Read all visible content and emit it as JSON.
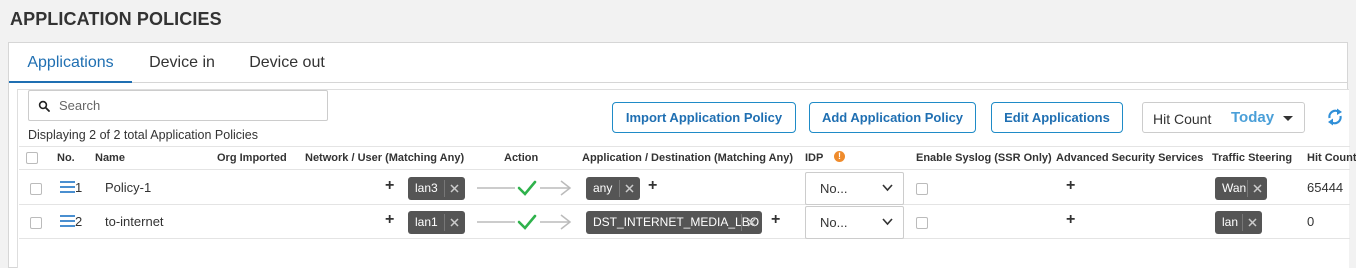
{
  "page": {
    "title": "APPLICATION POLICIES"
  },
  "tabs": [
    {
      "label": "Applications",
      "active": true
    },
    {
      "label": "Device in",
      "active": false
    },
    {
      "label": "Device out",
      "active": false
    }
  ],
  "search": {
    "placeholder": "Search",
    "value": ""
  },
  "summary": "Displaying 2 of 2 total Application Policies",
  "toolbar": {
    "import_label": "Import Application Policy",
    "add_label": "Add Application Policy",
    "edit_label": "Edit Applications",
    "hit_count_label": "Hit Count",
    "hit_count_value": "Today"
  },
  "table": {
    "columns": {
      "no": "No.",
      "name": "Name",
      "org_imported": "Org Imported",
      "network": "Network / User (Matching Any)",
      "action": "Action",
      "application": "Application / Destination (Matching Any)",
      "idp": "IDP",
      "syslog": "Enable Syslog (SSR Only)",
      "security": "Advanced Security Services",
      "steering": "Traffic Steering",
      "hit_count": "Hit Count"
    },
    "rows": [
      {
        "no": "1",
        "name": "Policy-1",
        "network": "lan3",
        "application": "any",
        "idp": "No...",
        "steering": "Wan",
        "hit_count": "65444"
      },
      {
        "no": "2",
        "name": "to-internet",
        "network": "lan1",
        "application": "DST_INTERNET_MEDIA_LBO",
        "idp": "No...",
        "steering": "lan",
        "hit_count": "0"
      }
    ]
  },
  "colors": {
    "accent": "#1f6fb2",
    "tag_bg": "#555555",
    "check_green": "#2fb24c",
    "info_orange": "#ef8b2c"
  },
  "icons": [
    "search-icon",
    "caret-down-icon",
    "refresh-icon",
    "drag-menu-icon",
    "close-icon",
    "check-icon",
    "arrow-right-icon",
    "chevron-down-icon",
    "info-icon",
    "plus-icon"
  ]
}
